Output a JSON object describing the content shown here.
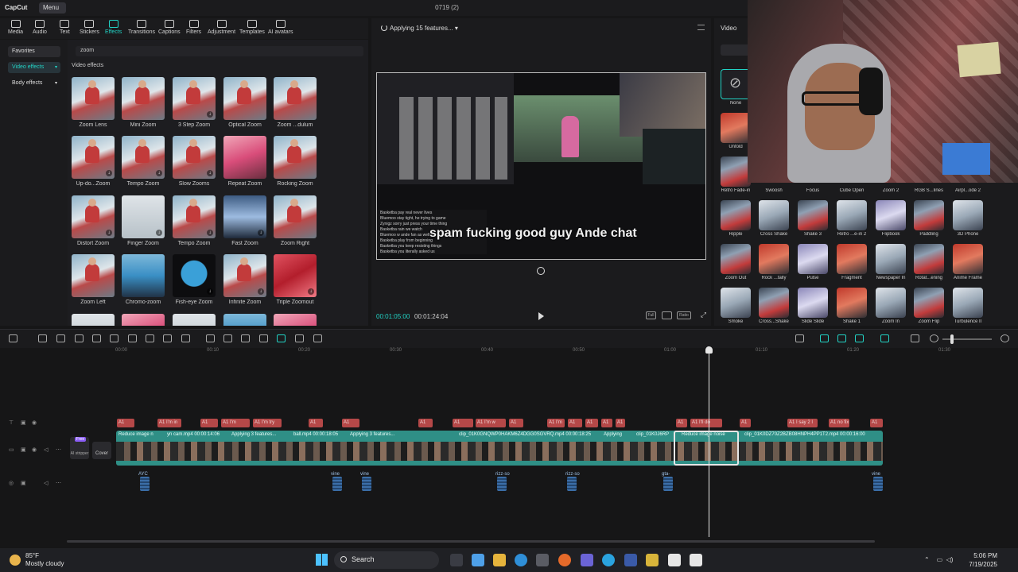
{
  "app": {
    "logo": "CapCut",
    "menu_label": "Menu",
    "window_title": "0719 (2)"
  },
  "tool_tabs": [
    {
      "label": "Media",
      "icon": "media-icon"
    },
    {
      "label": "Audio",
      "icon": "audio-icon"
    },
    {
      "label": "Text",
      "icon": "text-icon"
    },
    {
      "label": "Stickers",
      "icon": "stickers-icon"
    },
    {
      "label": "Effects",
      "icon": "effects-icon",
      "active": true
    },
    {
      "label": "Transitions",
      "icon": "transitions-icon"
    },
    {
      "label": "Captions",
      "icon": "captions-icon"
    },
    {
      "label": "Filters",
      "icon": "filters-icon"
    },
    {
      "label": "Adjustment",
      "icon": "adjustment-icon"
    },
    {
      "label": "Templates",
      "icon": "templates-icon"
    },
    {
      "label": "AI avatars",
      "icon": "ai-avatars-icon"
    }
  ],
  "left_categories": {
    "favorites": "Favorites",
    "video_effects": "Video effects",
    "body_effects": "Body effects"
  },
  "effects": {
    "search_value": "zoom",
    "section_title": "Video effects",
    "items": [
      "Zoom Lens",
      "Mini Zoom",
      "3 Step Zoom",
      "Optical Zoom",
      "Zoom ...dulum",
      "Up-do...Zoom",
      "Tempo Zoom",
      "Slow Zooms",
      "Repeat Zoom",
      "Rocking Zoom",
      "Distort Zoom",
      "Finger Zoom",
      "Tempo Zoom",
      "Fast Zoom",
      "Zoom Right",
      "Zoom Left",
      "Chromo-zoom",
      "Fish-eye Zoom",
      "Infinite Zoom",
      "Triple Zoomout"
    ]
  },
  "player": {
    "status": "Applying 15 features...",
    "current_time": "00:01:05:00",
    "total_time": "00:01:24:04",
    "caption": "spam fucking good guy Ande chat",
    "buttons": [
      "Full",
      "Ratio"
    ],
    "chat_lines": [
      {
        "user": "Basketba",
        "text": "pay real never lives"
      },
      {
        "user": "Bluemoo",
        "text": "stay tight, he trying to game"
      },
      {
        "user": "Zynigz",
        "text": "sorry just press your time thing"
      },
      {
        "user": "Basketba",
        "text": "rain we watch"
      },
      {
        "user": "Bluemoo",
        "text": "w ande fan as well"
      },
      {
        "user": "Basketba",
        "text": "play from beginning"
      },
      {
        "user": "Basketba",
        "text": "you keep resisting things"
      },
      {
        "user": "Basketba",
        "text": "you literally asked us"
      }
    ]
  },
  "transitions_panel": {
    "title": "Video",
    "items": [
      "None",
      "Unfold",
      "Retro Fade-in",
      "Swoosh",
      "Focus",
      "Cube Open",
      "Zoom 2",
      "RGB S...lines",
      "Airpl...ode 2",
      "Ripple",
      "Cross Shake",
      "Shake 3",
      "Retro ...e-in 2",
      "Flipbook",
      "Paddling",
      "3D Phone",
      "Zoom Out",
      "Rock ...tally",
      "Pulse",
      "Fragment",
      "Newspaper In",
      "Rotat...ening",
      "Anime Frame",
      "Smoke",
      "Cross...Shake",
      "Slide Slide",
      "Shake 1",
      "Zoom In",
      "Zoom Flip",
      "Turbulence II"
    ]
  },
  "timeline": {
    "ruler_labels": [
      "00:00",
      "00:10",
      "00:20",
      "00:30",
      "00:40",
      "00:50",
      "01:00",
      "01:10",
      "01:20",
      "01:30"
    ],
    "label_chips": [
      "A1",
      "A1 I'm in",
      "A1",
      "A1 I'm",
      "A1 I'm try",
      "A1",
      "A1",
      "A1",
      "A1",
      "A1 I'm w",
      "A1",
      "A1 I'm",
      "A1",
      "A1",
      "A1",
      "A1",
      "A1",
      "A1 I'll do",
      "A1",
      "A1 I say 2 I",
      "A1 no fix",
      "A1"
    ],
    "segments": [
      "Reduce image n",
      "yn cam.mp4  00:00:14:06",
      "Applying 3 features...",
      "ball.mp4  00:00:18:05",
      "Applying 3 features...",
      "clip_01K0GNQWP0HAKM6Z4DGG0SGVRQ.mp4  00:00:18:25",
      "Applying",
      "clip_01K0J6RP",
      "Reduce image noise",
      "clip_01K0DZ70Z2BZB08HNPH4PP1T2.mp4  00:00:16:00"
    ],
    "cover_label": "Cover",
    "ai_label": "AI stripper",
    "free_badge": "Free",
    "audio_labels": [
      "AYC",
      "vine",
      "vine",
      "rizz-so",
      "rizz-so",
      "gta-",
      "vine"
    ]
  },
  "taskbar": {
    "temperature": "85°F",
    "condition": "Mostly cloudy",
    "search_label": "Search",
    "time": "5:06 PM",
    "date": "7/19/2025"
  },
  "colors": {
    "accent": "#22d3c5",
    "track": "#2f8f86",
    "label_chip": "#b54848"
  }
}
